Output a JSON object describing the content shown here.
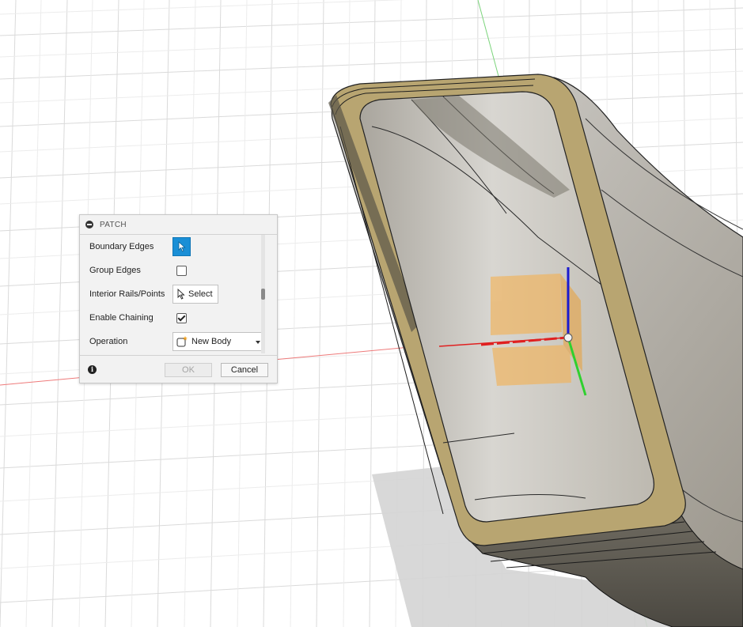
{
  "viewport": {
    "colors": {
      "grid": "#d9d9d9",
      "x_axis": "#e35b5b",
      "y_axis": "#55c455",
      "z_axis": "#2a2ad4",
      "body_rim": "#b9a472",
      "body_wall": "#c9c6bd",
      "plane": "#f2b35a",
      "shadow": "#cfcfcf"
    }
  },
  "dialog": {
    "title": "PATCH",
    "rows": [
      {
        "label": "Boundary Edges",
        "control": "selector-active",
        "icon": "cursor-arrow-icon"
      },
      {
        "label": "Group Edges",
        "control": "checkbox",
        "checked": false
      },
      {
        "label": "Interior Rails/Points",
        "control": "selector",
        "button_label": "Select",
        "icon": "cursor-arrow-icon"
      },
      {
        "label": "Enable Chaining",
        "control": "checkbox",
        "checked": true
      },
      {
        "label": "Operation",
        "control": "dropdown",
        "value": "New Body",
        "icon": "new-body-icon"
      }
    ],
    "footer": {
      "info_icon": "info-icon",
      "ok_label": "OK",
      "cancel_label": "Cancel"
    }
  }
}
